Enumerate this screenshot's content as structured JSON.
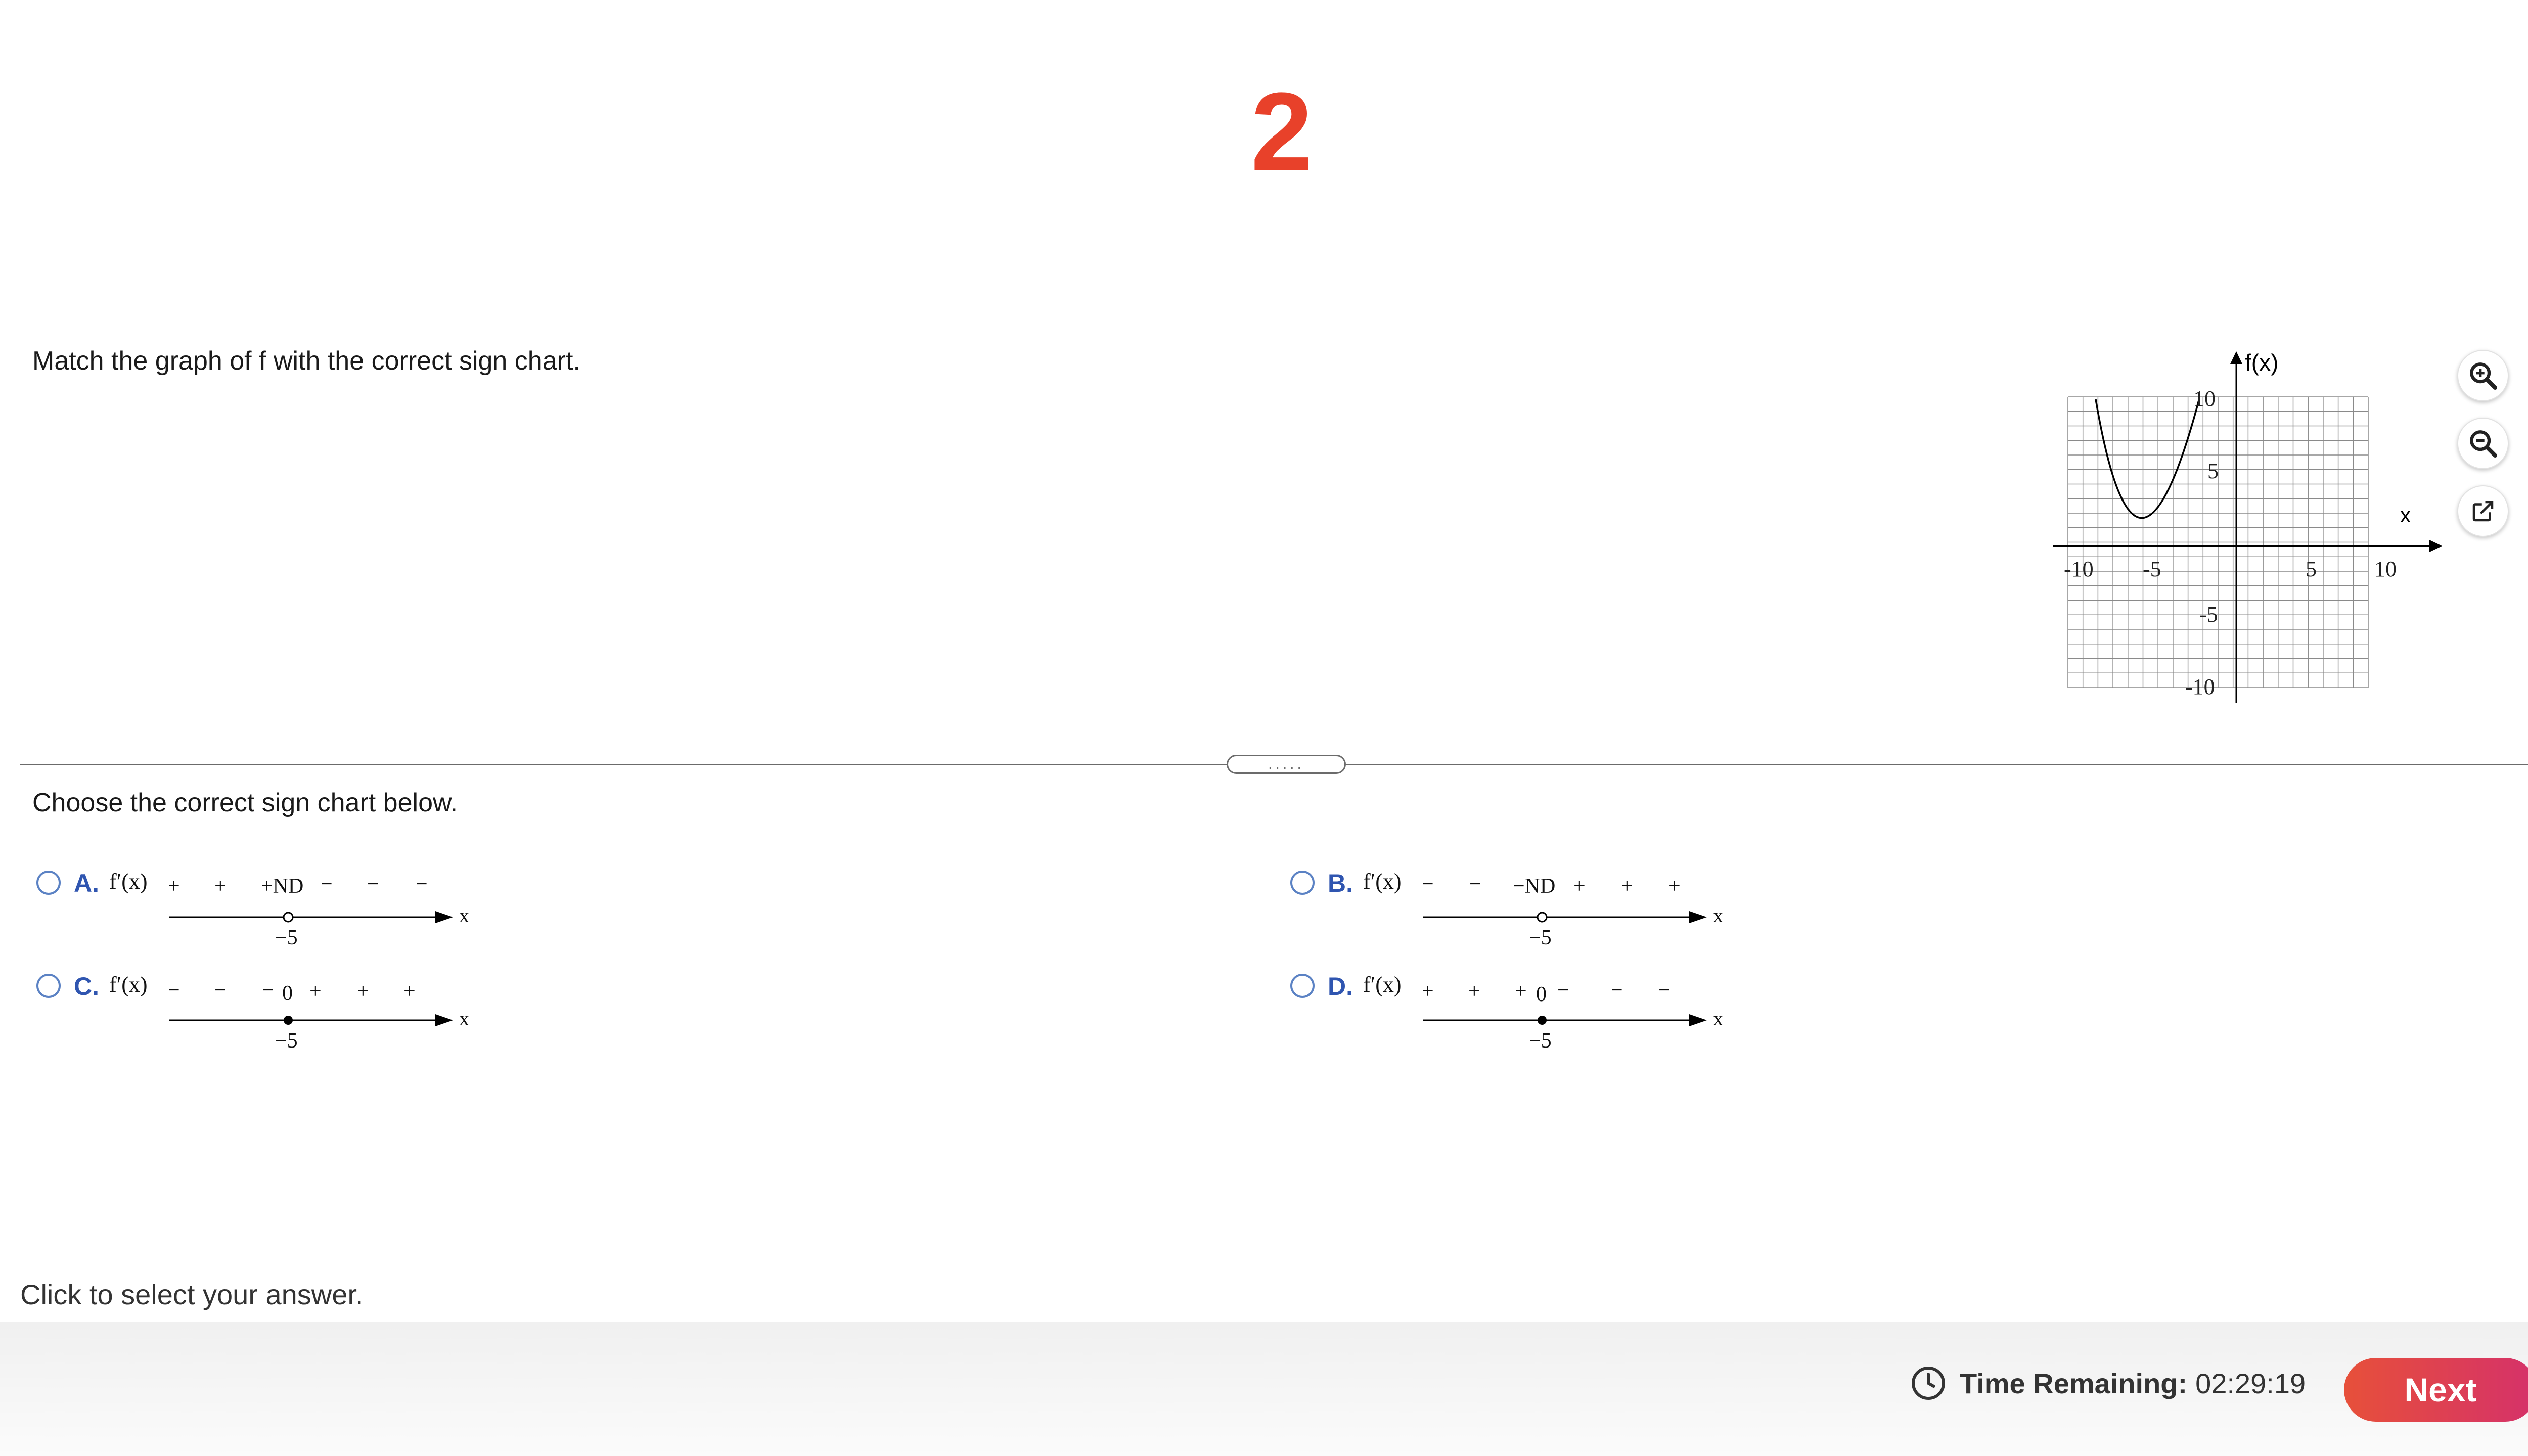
{
  "question_number": "2",
  "prompt": "Match the graph of f with the correct sign chart.",
  "graph": {
    "ylabel": "f(x)",
    "xlabel": "x",
    "x_ticks": [
      "-10",
      "-5",
      "5",
      "10"
    ],
    "y_ticks": [
      "10",
      "5",
      "-5",
      "-10"
    ],
    "xlim": [
      -10,
      10
    ],
    "ylim": [
      -10,
      10
    ]
  },
  "tools": {
    "zoom_in": "zoom-in-icon",
    "zoom_out": "zoom-out-icon",
    "popout": "external-link-icon"
  },
  "divider_handle": ".....",
  "choose_text": "Choose the correct sign chart below.",
  "options": [
    {
      "letter": "A.",
      "func": "f′(x)",
      "signs": [
        "+",
        "+",
        "+ND",
        "−",
        "−",
        "−"
      ],
      "point": "−5",
      "axis": "x",
      "marker": "open"
    },
    {
      "letter": "B.",
      "func": "f′(x)",
      "signs": [
        "−",
        "−",
        "−ND",
        "+",
        "+",
        "+"
      ],
      "point": "−5",
      "axis": "x",
      "marker": "open"
    },
    {
      "letter": "C.",
      "func": "f′(x)",
      "signs": [
        "−",
        "−",
        "−",
        "0",
        "+",
        "+",
        "+"
      ],
      "point": "−5",
      "axis": "x",
      "marker": "filled"
    },
    {
      "letter": "D.",
      "func": "f′(x)",
      "signs": [
        "+",
        "+",
        "+",
        "0",
        "−",
        "−",
        "−"
      ],
      "point": "−5",
      "axis": "x",
      "marker": "filled"
    }
  ],
  "hint": "Click to select your answer.",
  "timer": {
    "label": "Time Remaining:",
    "value": "02:29:19"
  },
  "next_label": "Next",
  "colors": {
    "accent": "#e8412a",
    "option_letter": "#2f55b0",
    "radio": "#5b82c4"
  }
}
